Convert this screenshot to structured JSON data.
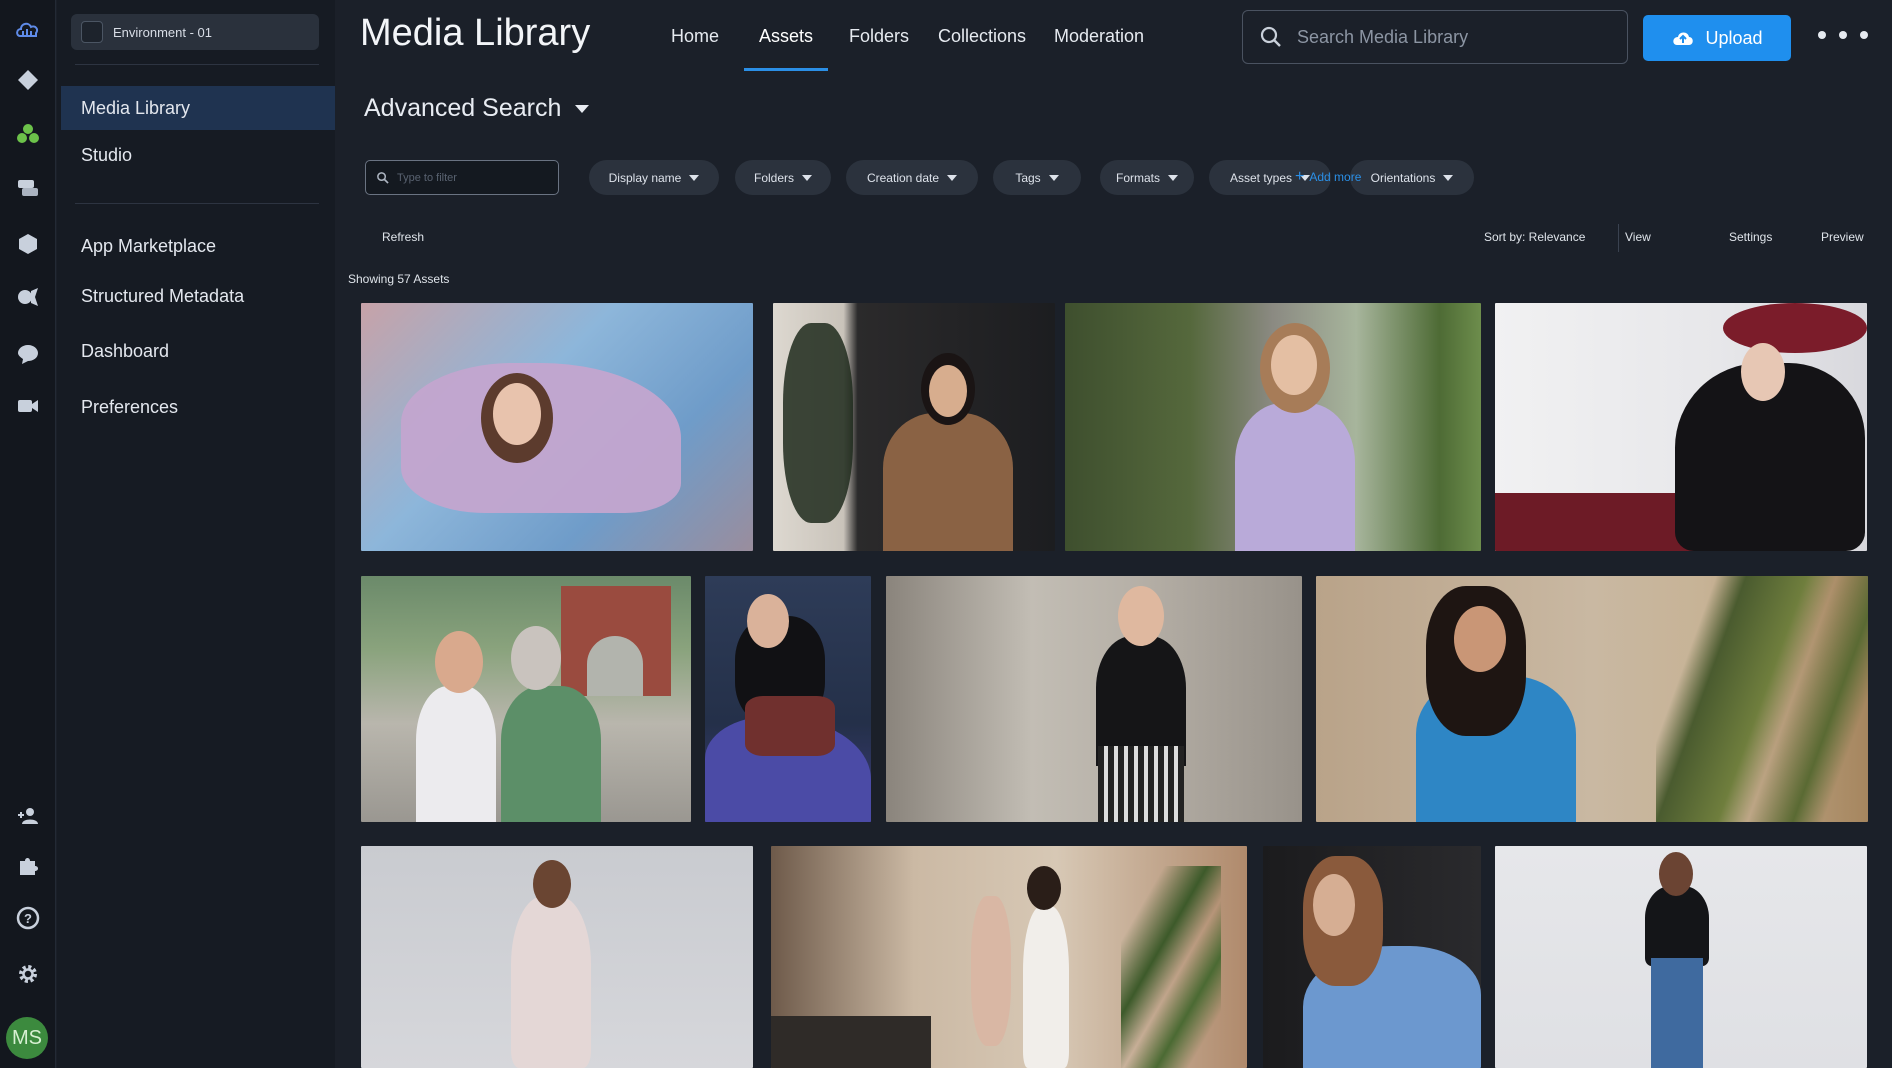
{
  "app": {
    "environment": "Environment - 01"
  },
  "sidebar": {
    "items": [
      {
        "label": "Media Library"
      },
      {
        "label": "Studio"
      },
      {
        "label": "App Marketplace"
      },
      {
        "label": "Structured Metadata"
      },
      {
        "label": "Dashboard"
      },
      {
        "label": "Preferences"
      }
    ],
    "avatar_initials": "MS"
  },
  "header": {
    "title": "Media Library",
    "tabs": [
      {
        "label": "Home"
      },
      {
        "label": "Assets"
      },
      {
        "label": "Folders"
      },
      {
        "label": "Collections"
      },
      {
        "label": "Moderation"
      }
    ],
    "search_placeholder": "Search Media Library",
    "upload_label": "Upload"
  },
  "search": {
    "title": "Advanced Search",
    "filter_placeholder": "Type to filter",
    "chips": [
      {
        "label": "Display name"
      },
      {
        "label": "Folders"
      },
      {
        "label": "Creation date"
      },
      {
        "label": "Tags"
      },
      {
        "label": "Formats"
      },
      {
        "label": "Asset types"
      },
      {
        "label": "Orientations"
      }
    ],
    "add_more": "Add more"
  },
  "toolbar": {
    "refresh": "Refresh",
    "sort": "Sort by: Relevance",
    "view": "View",
    "settings": "Settings",
    "preview": "Preview",
    "count": "Showing 57 Assets"
  },
  "assets_row_count": 12,
  "colors": {
    "accent": "#1f8fee",
    "background": "#1b2029",
    "sidebar_active": "#1f3350"
  }
}
